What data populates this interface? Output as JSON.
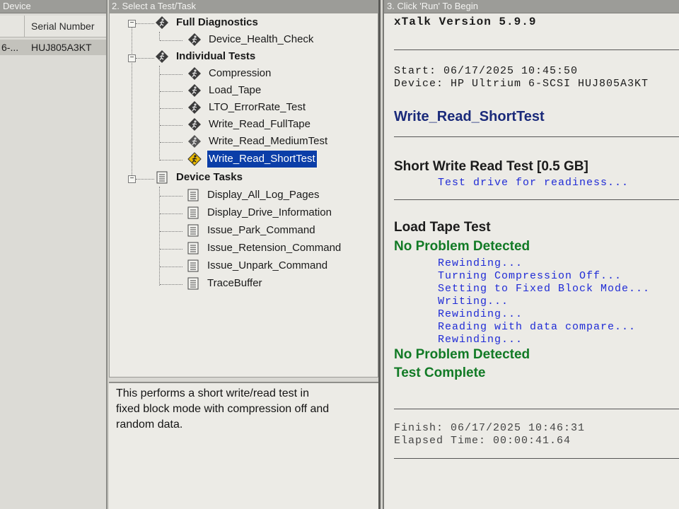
{
  "panel1": {
    "title": "Device",
    "column_serial": "Serial Number",
    "row": {
      "model": "6-...",
      "serial": "HUJ805A3KT"
    }
  },
  "panel2": {
    "title": "2. Select a Test/Task",
    "groups": [
      {
        "label": "Full Diagnostics",
        "items": [
          "Device_Health_Check"
        ]
      },
      {
        "label": "Individual Tests",
        "items": [
          "Compression",
          "Load_Tape",
          "LTO_ErrorRate_Test",
          "Write_Read_FullTape",
          "Write_Read_MediumTest",
          "Write_Read_ShortTest"
        ],
        "selected": "Write_Read_ShortTest"
      },
      {
        "label": "Device Tasks",
        "items": [
          "Display_All_Log_Pages",
          "Display_Drive_Information",
          "Issue_Park_Command",
          "Issue_Retension_Command",
          "Issue_Unpark_Command",
          "TraceBuffer"
        ]
      }
    ],
    "description": [
      "This performs a short write/read test in",
      "fixed block mode with compression off and",
      "random data."
    ]
  },
  "panel3": {
    "title": "3. Click 'Run' To Begin",
    "version": "xTalk Version 5.9.9",
    "start": "Start: 06/17/2025 10:45:50",
    "device": "Device: HP Ultrium 6-SCSI HUJ805A3KT",
    "test_name": "Write_Read_ShortTest",
    "short_test_title": "Short Write Read Test [0.5 GB]",
    "short_test_step": "Test drive for readiness...",
    "load_title": "Load Tape Test",
    "result1": "No Problem Detected",
    "steps": [
      "Rewinding...",
      "Turning Compression Off...",
      "Setting to Fixed Block Mode...",
      "Writing...",
      "Rewinding...",
      "Reading with data compare...",
      "Rewinding..."
    ],
    "result2": "No Problem Detected",
    "complete": "Test Complete",
    "finish": "Finish: 06/17/2025 10:46:31",
    "elapsed": "Elapsed Time: 00:00:41.64"
  },
  "colors": {
    "selection": "#0b3ea8",
    "log_blue": "#1f2bd6",
    "log_green": "#117a25"
  },
  "icons": {
    "diagnostic": "running-person-diamond-icon",
    "task": "document-list-icon"
  }
}
